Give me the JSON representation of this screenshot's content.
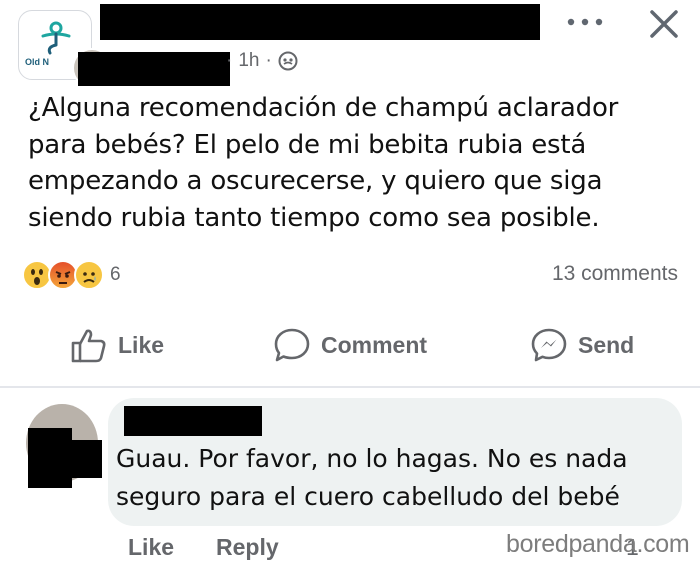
{
  "header": {
    "group_avatar_text": "Old N",
    "time": "1h",
    "separator": "·",
    "privacy_icon": "globe-icon",
    "more_icon": "more-horizontal-icon",
    "close_icon": "close-icon"
  },
  "post": {
    "text": "¿Alguna recomendación de champú aclarador\npara bebés? El pelo de mi bebita rubia está\nempezando a oscurecerse, y quiero que siga\nsiendo rubia tanto tiempo como sea posible."
  },
  "reactions": {
    "types": [
      "wow",
      "angry",
      "sad"
    ],
    "count": "6",
    "comments_count": "13 comments"
  },
  "actions": {
    "like_label": "Like",
    "comment_label": "Comment",
    "send_label": "Send"
  },
  "comment": {
    "text": "Guau. Por favor, no lo hagas. No es nada\nseguro para el cuero cabelludo del bebé",
    "like_label": "Like",
    "reply_label": "Reply",
    "like_count": "1"
  },
  "watermark": "boredpanda.com",
  "colors": {
    "secondary_text": "#65676b",
    "comment_bubble": "#eef2f2",
    "redaction": "#000000"
  }
}
